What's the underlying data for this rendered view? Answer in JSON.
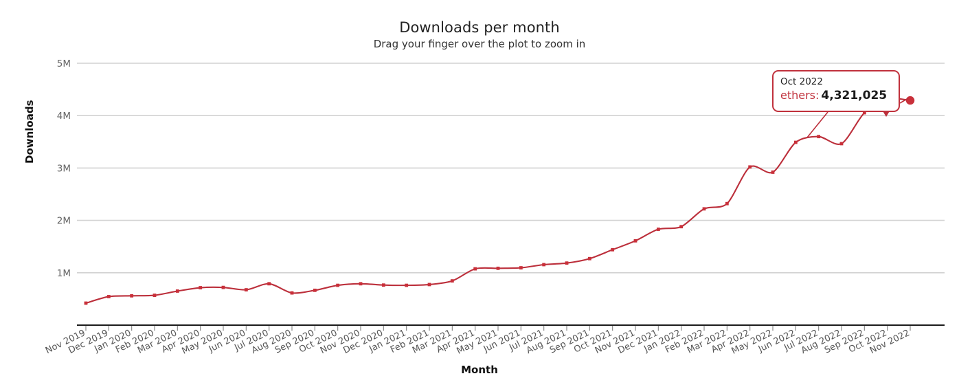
{
  "chart_data": {
    "type": "line",
    "title": "Downloads per month",
    "subtitle": "Drag your finger over the plot to zoom in",
    "xlabel": "Month",
    "ylabel": "Downloads",
    "series_name": "ethers",
    "line_color": "#bc2f3b",
    "marker_color": "#c9303a",
    "grid": true,
    "legend": "none",
    "ylim": [
      0,
      5000000
    ],
    "ytick_values": [
      1000000,
      2000000,
      3000000,
      4000000,
      5000000
    ],
    "ytick_labels": [
      "1M",
      "2M",
      "3M",
      "4M",
      "5M"
    ],
    "categories": [
      "Nov 2019",
      "Dec 2019",
      "Jan 2020",
      "Feb 2020",
      "Mar 2020",
      "Apr 2020",
      "May 2020",
      "Jun 2020",
      "Jul 2020",
      "Aug 2020",
      "Sep 2020",
      "Oct 2020",
      "Nov 2020",
      "Dec 2020",
      "Jan 2021",
      "Feb 2021",
      "Mar 2021",
      "Apr 2021",
      "May 2021",
      "Jun 2021",
      "Jul 2021",
      "Aug 2021",
      "Sep 2021",
      "Oct 2021",
      "Nov 2021",
      "Dec 2021",
      "Jan 2022",
      "Feb 2022",
      "Mar 2022",
      "Apr 2022",
      "May 2022",
      "Jun 2022",
      "Jul 2022",
      "Aug 2022",
      "Sep 2022",
      "Oct 2022",
      "Nov 2022"
    ],
    "values": [
      420000,
      545000,
      560000,
      570000,
      650000,
      715000,
      720000,
      675000,
      790000,
      615000,
      665000,
      760000,
      790000,
      765000,
      760000,
      775000,
      845000,
      1075000,
      1085000,
      1095000,
      1155000,
      1185000,
      1270000,
      1440000,
      1610000,
      1830000,
      1880000,
      2220000,
      2320000,
      3020000,
      2920000,
      3490000,
      3600000,
      3465000,
      4055000,
      4321025,
      4290000
    ],
    "highlight_index": 36
  },
  "tooltip": {
    "date": "Oct 2022",
    "series_label": "ethers:",
    "value": "4,321,025"
  }
}
